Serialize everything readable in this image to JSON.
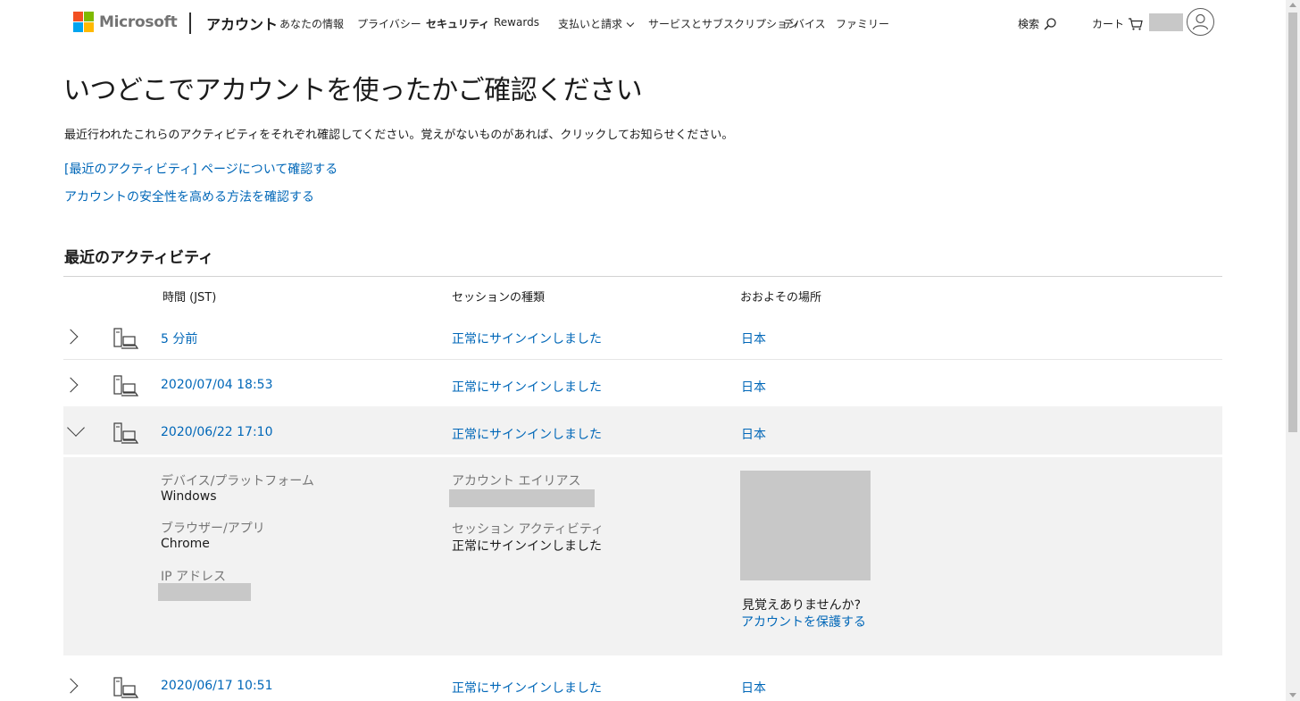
{
  "header": {
    "logo_text": "Microsoft",
    "account_label": "アカウント",
    "nav": [
      {
        "label": "あなたの情報"
      },
      {
        "label": "プライバシー"
      },
      {
        "label": "セキュリティ"
      },
      {
        "label": "Rewards"
      },
      {
        "label": "支払いと請求"
      },
      {
        "label": "サービスとサブスクリプション"
      },
      {
        "label": "デバイス"
      },
      {
        "label": "ファミリー"
      }
    ],
    "search_label": "検索",
    "cart_label": "カート",
    "icons": {
      "search": "search-icon",
      "cart": "cart-icon",
      "avatar": "user-avatar-icon",
      "dropdown": "chevron-down-icon"
    }
  },
  "colors": {
    "link": "#0067b8",
    "text": "#1b1b1b",
    "muted": "#767676",
    "expanded_bg": "#f2f2f2",
    "logo": [
      "#f25022",
      "#7fba00",
      "#00a4ef",
      "#ffb900"
    ]
  },
  "page": {
    "title": "いつどこでアカウントを使ったかご確認ください",
    "description": "最近行われたこれらのアクティビティをそれぞれ確認してください。覚えがないものがあれば、クリックしてお知らせください。",
    "link_recent_activity": "[最近のアクティビティ] ページについて確認する",
    "link_security_tips": "アカウントの安全性を高める方法を確認する",
    "section_title": "最近のアクティビティ"
  },
  "table": {
    "columns": [
      "時間 (JST)",
      "セッションの種類",
      "おおよその場所"
    ],
    "rows": [
      {
        "time": "5 分前",
        "session": "正常にサインインしました",
        "location": "日本",
        "expanded": false
      },
      {
        "time": "2020/07/04 18:53",
        "session": "正常にサインインしました",
        "location": "日本",
        "expanded": false
      },
      {
        "time": "2020/06/22 17:10",
        "session": "正常にサインインしました",
        "location": "日本",
        "expanded": true
      },
      {
        "time": "2020/06/17 10:51",
        "session": "正常にサインインしました",
        "location": "日本",
        "expanded": false
      }
    ]
  },
  "detail": {
    "device_label": "デバイス/プラットフォーム",
    "device_value": "Windows",
    "browser_label": "ブラウザー/アプリ",
    "browser_value": "Chrome",
    "ip_label": "IP アドレス",
    "alias_label": "アカウント エイリアス",
    "session_activity_label": "セッション アクティビティ",
    "session_activity_value": "正常にサインインしました",
    "unfamiliar_label": "見覚えありませんか?",
    "protect_link": "アカウントを保護する"
  }
}
